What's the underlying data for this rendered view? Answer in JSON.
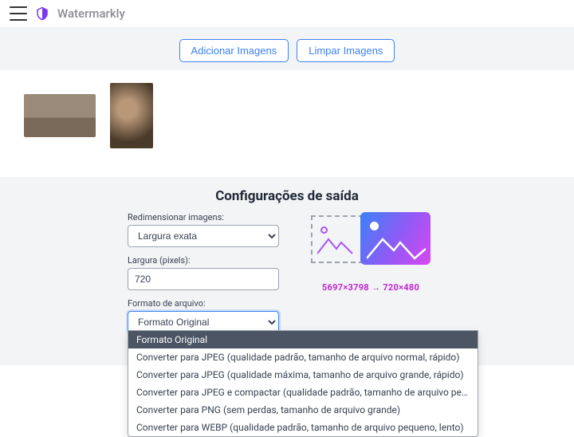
{
  "brand": "Watermarkly",
  "actions": {
    "add": "Adicionar Imagens",
    "clear": "Limpar Imagens"
  },
  "settings": {
    "title": "Configurações de saída",
    "resize_label": "Redimensionar imagens:",
    "resize_value": "Largura exata",
    "width_label": "Largura (pixels):",
    "width_value": "720",
    "format_label": "Formato de arquivo:",
    "format_value": "Formato Original",
    "dimensions": "5697×3798 → 720×480"
  },
  "format_options": [
    "Formato Original",
    "Converter para JPEG (qualidade padrão, tamanho de arquivo normal, rápido)",
    "Converter para JPEG (qualidade máxima, tamanho de arquivo grande, rápido)",
    "Converter para JPEG e compactar (qualidade padrão, tamanho de arquivo pequeno, lento)",
    "Converter para PNG (sem perdas, tamanho de arquivo grande)",
    "Converter para WEBP (qualidade padrão, tamanho de arquivo pequeno, lento)"
  ]
}
